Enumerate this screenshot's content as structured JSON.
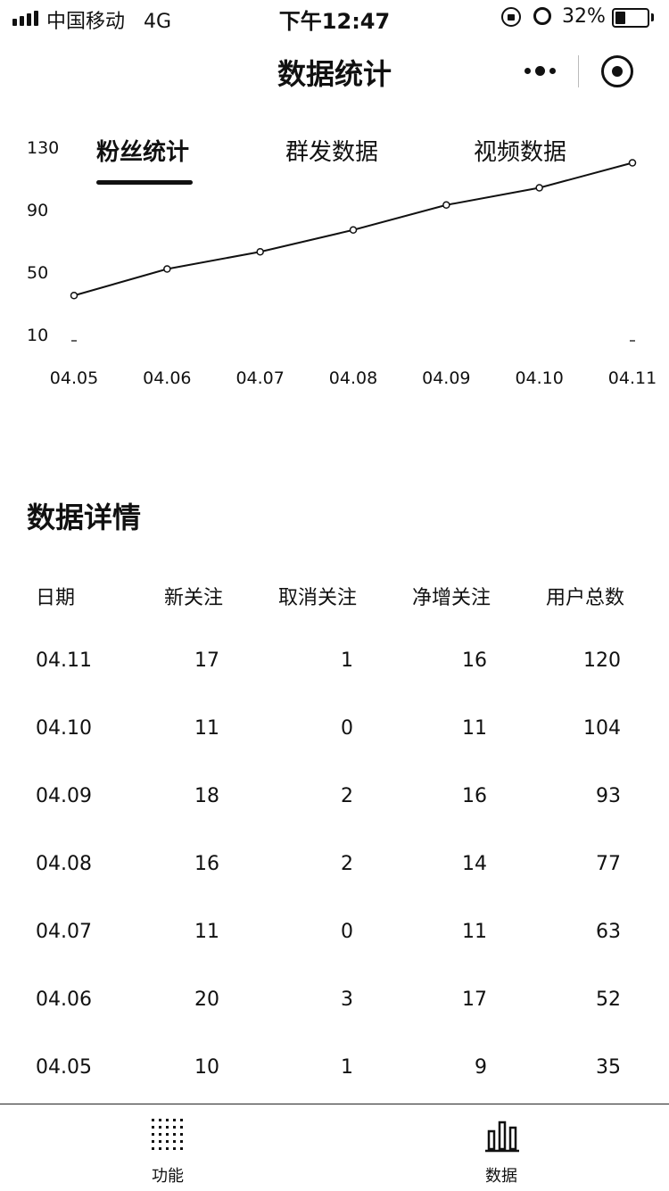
{
  "status": {
    "carrier": "中国移动",
    "network": "4G",
    "time": "下午12:47",
    "battery_pct": "32%",
    "battery_level": 0.32
  },
  "nav": {
    "title": "数据统计",
    "more_icon": "more-dots-icon",
    "close_icon": "target-icon"
  },
  "tabs": [
    {
      "label": "粉丝统计",
      "active": true
    },
    {
      "label": "群发数据",
      "active": false
    },
    {
      "label": "视频数据",
      "active": false
    }
  ],
  "chart_data": {
    "type": "line",
    "categories": [
      "04.05",
      "04.06",
      "04.07",
      "04.08",
      "04.09",
      "04.10",
      "04.11"
    ],
    "yticks": [
      "10",
      "50",
      "90",
      "130"
    ],
    "ylim": [
      10,
      130
    ],
    "series": [
      {
        "values": [
          35,
          52,
          63,
          77,
          93,
          104,
          120
        ]
      }
    ],
    "grid": false
  },
  "details": {
    "title": "数据详情",
    "columns": [
      "日期",
      "新关注",
      "取消关注",
      "净增关注",
      "用户总数"
    ],
    "rows": [
      [
        "04.11",
        "17",
        "1",
        "16",
        "120"
      ],
      [
        "04.10",
        "11",
        "0",
        "11",
        "104"
      ],
      [
        "04.09",
        "18",
        "2",
        "16",
        "93"
      ],
      [
        "04.08",
        "16",
        "2",
        "14",
        "77"
      ],
      [
        "04.07",
        "11",
        "0",
        "11",
        "63"
      ],
      [
        "04.06",
        "20",
        "3",
        "17",
        "52"
      ],
      [
        "04.05",
        "10",
        "1",
        "9",
        "35"
      ]
    ]
  },
  "tabbar": {
    "items": [
      {
        "label": "功能",
        "icon": "grid-dots-icon"
      },
      {
        "label": "数据",
        "icon": "bar-chart-icon"
      }
    ]
  }
}
